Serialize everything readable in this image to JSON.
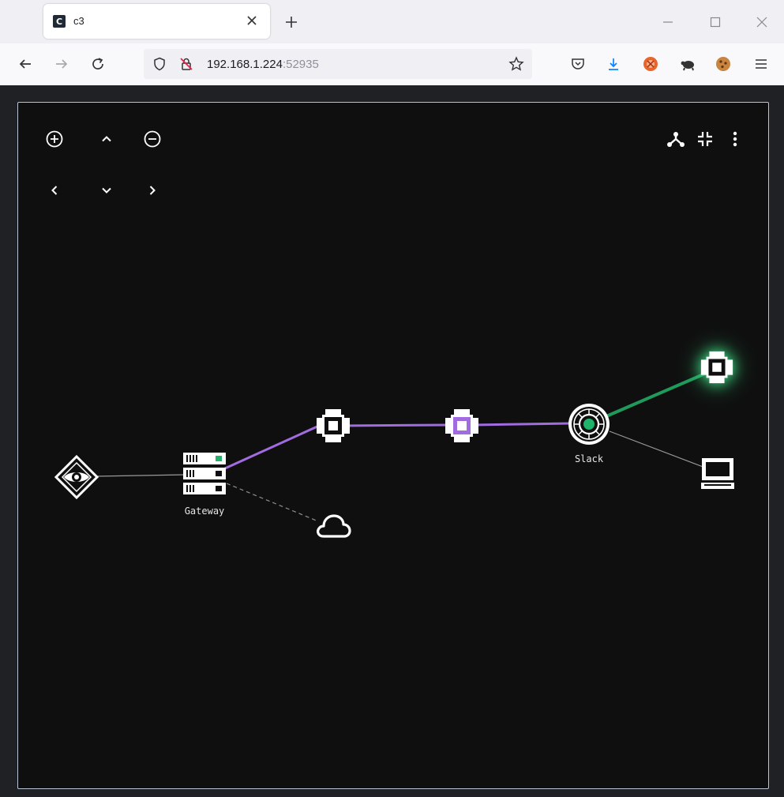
{
  "browser": {
    "tab": {
      "title": "c3",
      "favicon_letter": "C"
    },
    "url": {
      "host": "192.168.1.224",
      "port": ":52935"
    }
  },
  "graph": {
    "labels": {
      "gateway": "Gateway",
      "slack": "Slack"
    }
  },
  "colors": {
    "purple_link": "#a06ce0",
    "green_link": "#1f9a5a",
    "node_glow": "#3ddc84",
    "canvas_bg": "#0f0f0f",
    "frame_border": "#b9c4d6"
  },
  "icons": {
    "zoom_in": "zoom-in-icon",
    "zoom_out": "zoom-out-icon",
    "pan": [
      "chevron-up-icon",
      "chevron-down-icon",
      "chevron-left-icon",
      "chevron-right-icon"
    ],
    "top_right": [
      "graph-layout-icon",
      "collapse-icon",
      "more-vertical-icon"
    ],
    "nodes": [
      "eye-diamond-icon",
      "server-rack-icon",
      "chip-node-icon",
      "cloud-icon",
      "target-node-icon",
      "monitor-icon"
    ]
  }
}
